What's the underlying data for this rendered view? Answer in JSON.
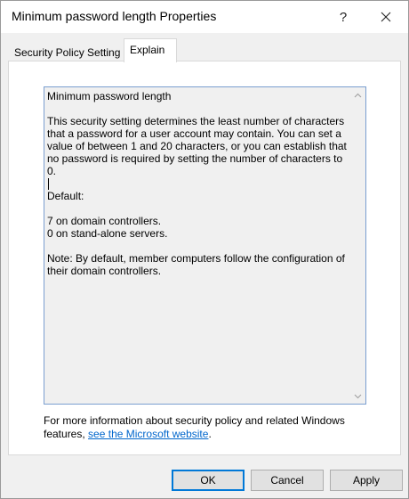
{
  "window": {
    "title": "Minimum password length Properties",
    "help_label": "?",
    "close_icon": "close-icon"
  },
  "tabs": [
    {
      "label": "Security Policy Setting",
      "selected": false
    },
    {
      "label": "Explain",
      "selected": true
    }
  ],
  "explain": {
    "heading": "Minimum password length",
    "paragraph1": "This security setting determines the least number of characters that a password for a user account may contain. You can set a value of between 1 and 20 characters, or you can establish that no password is required by setting the number of characters to 0.",
    "default_label": "Default:",
    "default_line1": "7 on domain controllers.",
    "default_line2": "0 on stand-alone servers.",
    "note": "Note: By default, member computers follow the configuration of their domain controllers."
  },
  "more_info": {
    "text": "For more information about security policy and related Windows features,",
    "link_text": "see the Microsoft website",
    "trailing": "."
  },
  "buttons": {
    "ok": "OK",
    "cancel": "Cancel",
    "apply": "Apply"
  },
  "colors": {
    "accent": "#0078d7",
    "link": "#0066cc",
    "explain_border": "#7a9fd0"
  }
}
